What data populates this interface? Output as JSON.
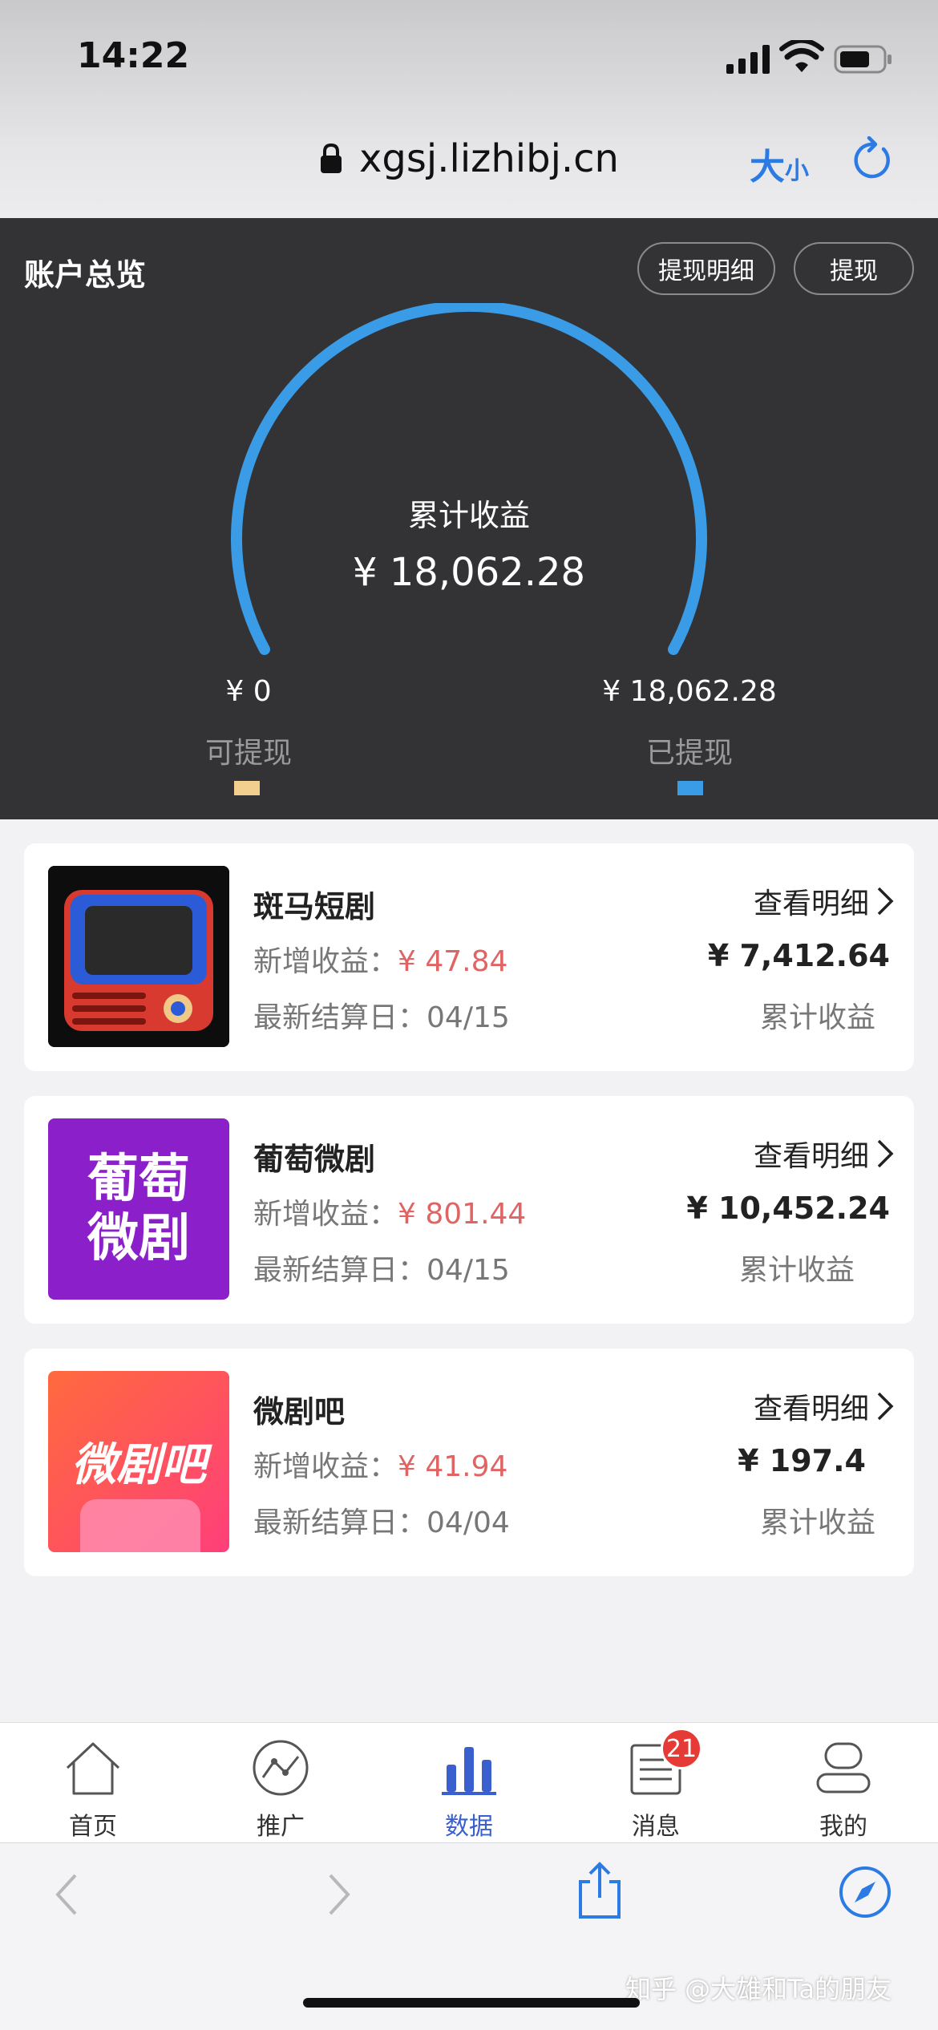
{
  "status_bar": {
    "time": "14:22"
  },
  "browser": {
    "url": "xgsj.lizhibj.cn",
    "text_size_big": "大",
    "text_size_small": "小"
  },
  "overview": {
    "title": "账户总览",
    "detail_button": "提现明细",
    "withdraw_button": "提现",
    "gauge": {
      "center_label": "累计收益",
      "center_value": "¥ 18,062.28",
      "left_value": "¥ 0",
      "left_label": "可提现",
      "right_value": "¥ 18,062.28",
      "right_label": "已提现",
      "withdrawn_fraction": 1.0
    },
    "colors": {
      "arc": "#3a9be6",
      "available": "#f2cf8e",
      "withdrawn": "#3a9be6"
    }
  },
  "cards": [
    {
      "name": "斑马短剧",
      "new_label": "新增收益：",
      "new_value": "¥ 47.84",
      "date_label": "最新结算日：",
      "date": "04/15",
      "link": "查看明细",
      "total": "¥ 7,412.64",
      "total_label": "累计收益",
      "icon": "tv-icon"
    },
    {
      "name": "葡萄微剧",
      "new_label": "新增收益：",
      "new_value": "¥ 801.44",
      "date_label": "最新结算日：",
      "date": "04/15",
      "link": "查看明细",
      "total": "¥ 10,452.24",
      "total_label": "累计收益",
      "icon_text_1": "葡萄",
      "icon_text_2": "微剧"
    },
    {
      "name": "微剧吧",
      "new_label": "新增收益：",
      "new_value": "¥ 41.94",
      "date_label": "最新结算日：",
      "date": "04/04",
      "link": "查看明细",
      "total": "¥ 197.4",
      "total_label": "累计收益",
      "icon_text": "微剧吧"
    }
  ],
  "tabbar": {
    "items": [
      {
        "label": "首页",
        "icon": "home-icon"
      },
      {
        "label": "推广",
        "icon": "promote-icon"
      },
      {
        "label": "数据",
        "icon": "bar-chart-icon",
        "active": true
      },
      {
        "label": "消息",
        "icon": "message-icon",
        "badge": "21"
      },
      {
        "label": "我的",
        "icon": "profile-icon"
      }
    ]
  },
  "watermark": "知乎 @大雄和Ta的朋友"
}
